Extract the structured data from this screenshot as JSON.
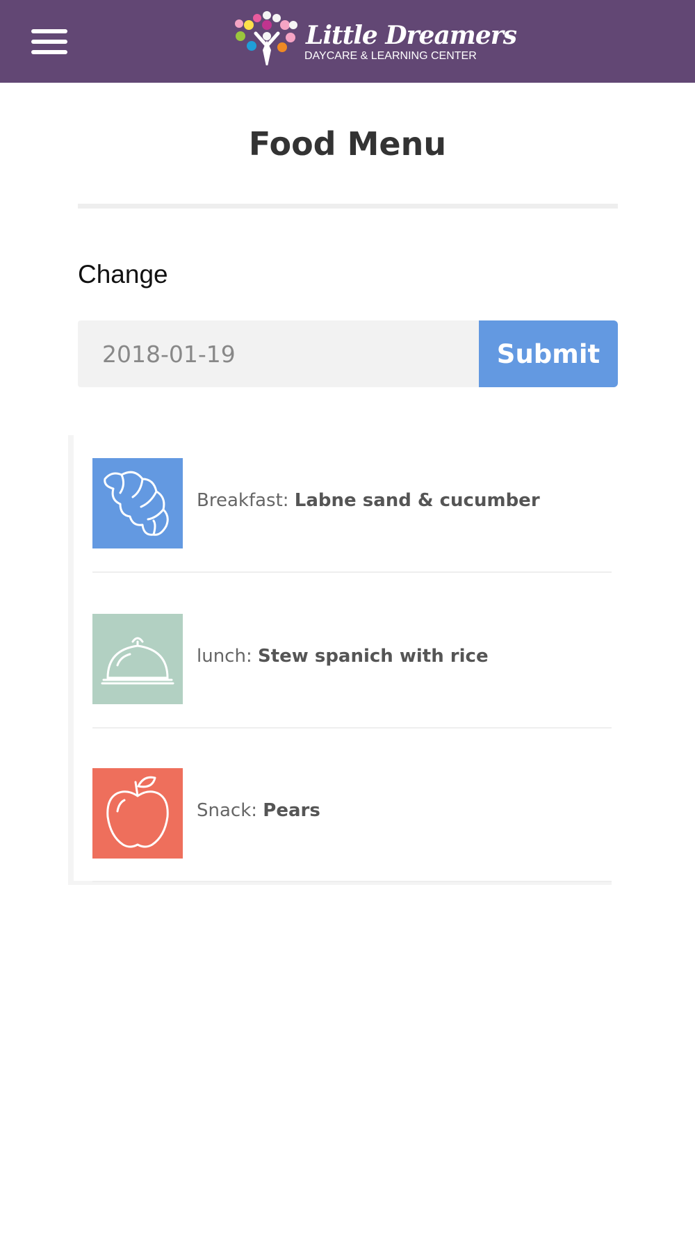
{
  "header": {
    "brand_name": "Little Dreamers",
    "brand_tagline": "DAYCARE & LEARNING CENTER",
    "background_color": "#624774",
    "menu_icon": "hamburger-menu-icon"
  },
  "page": {
    "title": "Food Menu"
  },
  "date_form": {
    "label": "Change",
    "date_value": "2018-01-19",
    "submit_label": "Submit",
    "accent_color": "#6399e1"
  },
  "meals": [
    {
      "label": "Breakfast: ",
      "item": "Labne sand & cucumber",
      "icon": "croissant-icon",
      "color": "#6399e1"
    },
    {
      "label": "lunch: ",
      "item": "Stew spanich with rice",
      "icon": "cloche-icon",
      "color": "#b2d0c2"
    },
    {
      "label": "Snack: ",
      "item": "Pears",
      "icon": "apple-icon",
      "color": "#ee6f5c"
    }
  ]
}
